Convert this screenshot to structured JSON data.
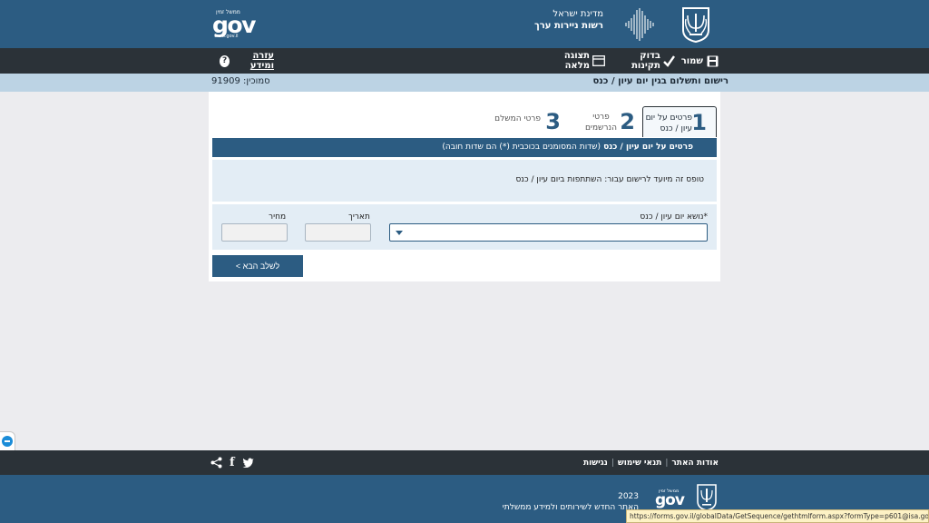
{
  "header": {
    "authority_line1": "מדינת ישראל",
    "authority_line2": "רשות ניירות ערך",
    "gov_logo_top": "ממשל זמין",
    "gov_logo_word": "gov",
    "gov_logo_url": "www.gov.il"
  },
  "toolbar": {
    "save_label": "שמור",
    "check_label": "בדוק תקינות",
    "fullview_label": "תצוגה מלאה",
    "help_label": "עזרה ומידע",
    "help_icon": "?"
  },
  "title_strip": {
    "page_title": "רישום ותשלום בגין יום עיון / כנס",
    "reference": "סמוכין: 91909"
  },
  "tabs": [
    {
      "number": "1",
      "line1": "פרטים על יום",
      "line2": "עיון / כנס",
      "active": true
    },
    {
      "number": "2",
      "line1": "פרטי",
      "line2": "הנרשמים",
      "active": false
    },
    {
      "number": "3",
      "line1": "פרטי המשלם",
      "line2": "",
      "active": false
    }
  ],
  "section": {
    "title": "פרטים על יום עיון / כנס",
    "subtitle": "(שדות המסומנים בכוכבית (*) הם שדות חובה)"
  },
  "info": {
    "text": "טופס זה מיועד לרישום עבור: השתתפות ביום עיון / כנס"
  },
  "fields": {
    "subject_label": "*נושא יום עיון / כנס",
    "subject_value": "",
    "date_label": "תאריך",
    "date_value": "",
    "price_label": "מחיר",
    "price_value": ""
  },
  "next_button": "לשלב הבא >",
  "footer": {
    "links": [
      "אודות האתר",
      "תנאי שימוש",
      "נגישות"
    ],
    "year": "2023",
    "tagline": "האתר החדש לשירותים ולמידע ממשלתי",
    "gov_word": "gov",
    "gov_top": "ממשל זמין"
  },
  "status_url": "https://forms.gov.il/globalData/GetSequence/gethtmlform.aspx?formType=p601@isa.gov.il#",
  "colors": {
    "header_blue": "#2c5c82",
    "toolbar_dark": "#2b3238",
    "strip_light": "#bcd3e4",
    "panel_light": "#e3edf5"
  }
}
